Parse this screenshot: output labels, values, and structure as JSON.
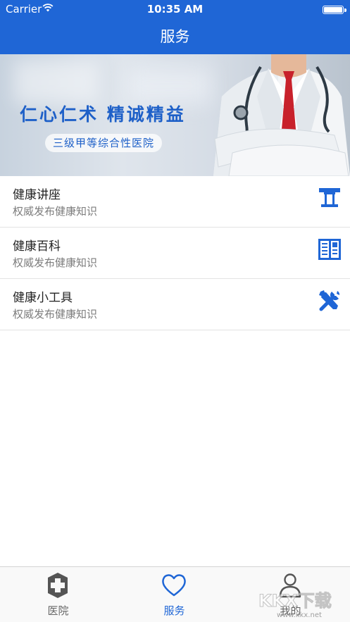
{
  "status_bar": {
    "carrier": "Carrier",
    "time": "10:35 AM"
  },
  "header": {
    "title": "服务"
  },
  "banner": {
    "slogan": "仁心仁术  精诚精益",
    "hospital_level": "三级甲等综合性医院"
  },
  "services": [
    {
      "title": "健康讲座",
      "subtitle": "权威发布健康知识",
      "icon": "lecture-podium-icon"
    },
    {
      "title": "健康百科",
      "subtitle": "权威发布健康知识",
      "icon": "encyclopedia-book-icon"
    },
    {
      "title": "健康小工具",
      "subtitle": "权威发布健康知识",
      "icon": "tools-icon"
    }
  ],
  "tabbar": {
    "tabs": [
      {
        "label": "医院",
        "icon": "hospital-cross-icon",
        "active": false
      },
      {
        "label": "服务",
        "icon": "heart-icon",
        "active": true
      },
      {
        "label": "我的",
        "icon": "user-icon",
        "active": false
      }
    ]
  },
  "watermark": {
    "text": "KKX下载",
    "url": "www.kkx.net"
  },
  "colors": {
    "primary": "#1f66d6",
    "text": "#222222",
    "subtext": "#7c7c7c",
    "inactive_tab": "#666666"
  }
}
